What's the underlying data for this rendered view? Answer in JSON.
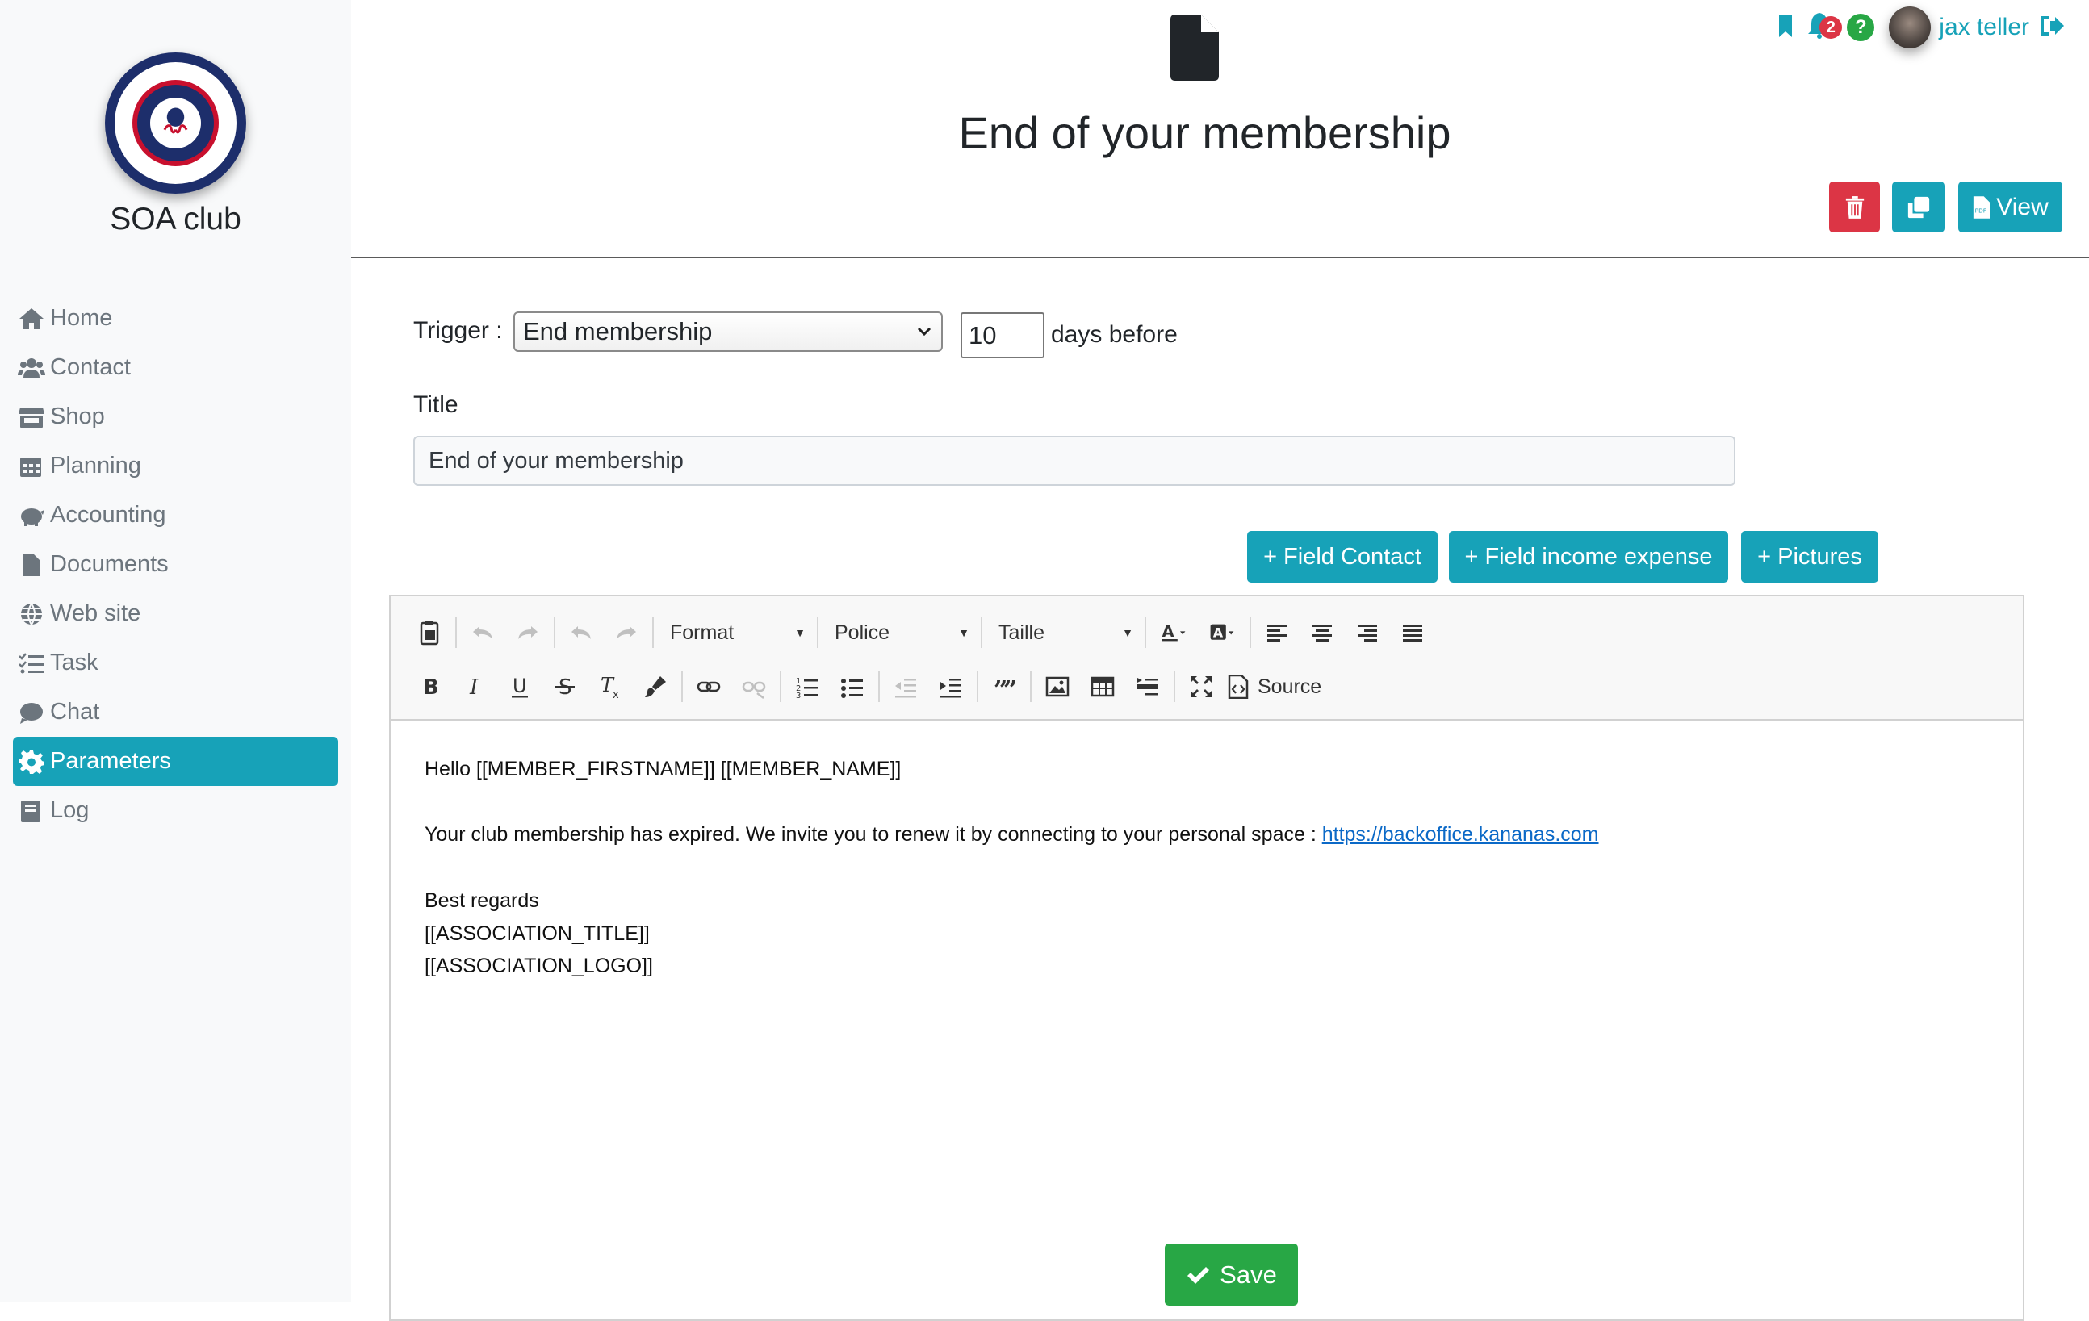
{
  "sidebar": {
    "club_name": "SOA club",
    "items": [
      {
        "label": "Home",
        "icon": "home-icon"
      },
      {
        "label": "Contact",
        "icon": "users-icon"
      },
      {
        "label": "Shop",
        "icon": "store-icon"
      },
      {
        "label": "Planning",
        "icon": "calendar-icon"
      },
      {
        "label": "Accounting",
        "icon": "piggy-bank-icon"
      },
      {
        "label": "Documents",
        "icon": "file-icon"
      },
      {
        "label": "Web site",
        "icon": "globe-icon"
      },
      {
        "label": "Task",
        "icon": "tasks-icon"
      },
      {
        "label": "Chat",
        "icon": "comment-icon"
      },
      {
        "label": "Parameters",
        "icon": "gear-icon",
        "active": true
      },
      {
        "label": "Log",
        "icon": "book-icon"
      }
    ]
  },
  "header": {
    "page_title": "End of your membership",
    "notifications_count": "2",
    "help_label": "?",
    "user_name": "jax teller",
    "view_label": "View"
  },
  "form": {
    "trigger_label": "Trigger :",
    "trigger_value": "End membership",
    "days_value": "10",
    "days_label": "days before",
    "title_label": "Title",
    "title_value": "End of your membership",
    "buttons": {
      "field_contact": "+ Field Contact",
      "field_income_expense": "+ Field income expense",
      "pictures": "+ Pictures"
    }
  },
  "editor": {
    "toolbar": {
      "format": "Format",
      "police": "Police",
      "taille": "Taille",
      "source": "Source"
    },
    "body": {
      "line1": "Hello [[MEMBER_FIRSTNAME]] [[MEMBER_NAME]]",
      "line2": "Your club membership has expired. We invite you to renew it by connecting to your personal space : ",
      "link": "https://backoffice.kananas.com",
      "line3": "Best regards",
      "line4": "[[ASSOCIATION_TITLE]]",
      "line5": "[[ASSOCIATION_LOGO]]"
    }
  },
  "save_label": "Save",
  "colors": {
    "accent": "#17a2b8",
    "danger": "#dc3545",
    "success": "#28a745",
    "link": "#0b69c7"
  }
}
